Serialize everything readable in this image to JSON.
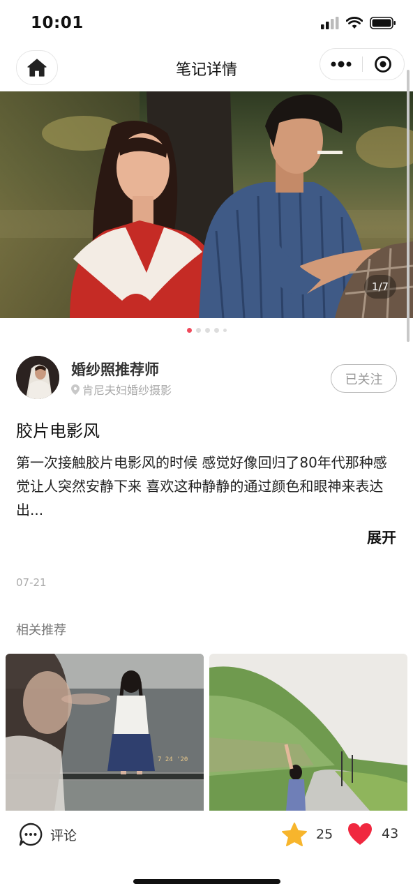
{
  "status_bar": {
    "time": "10:01"
  },
  "nav": {
    "title": "笔记详情"
  },
  "hero": {
    "counter": "1/7",
    "current_index": 1,
    "total": 7
  },
  "author": {
    "name": "婚纱照推荐师",
    "location": "肯尼夫妇婚纱摄影",
    "follow_label": "已关注"
  },
  "note": {
    "title": "胶片电影风",
    "body": "第一次接触胶片电影风的时候 感觉好像回归了80年代那种感觉让人突然安静下来 喜欢这种静静的通过颜色和眼神来表达出...",
    "expand_label": "展开",
    "date": "07-21"
  },
  "related": {
    "title": "相关推荐"
  },
  "bottom_bar": {
    "comment_label": "评论",
    "star_count": "25",
    "like_count": "43"
  },
  "colors": {
    "accent_red": "#f0283f",
    "star_yellow": "#f7b52c",
    "dot_active": "#f04a5b"
  },
  "icons": [
    "home-icon",
    "more-icon",
    "close-target-icon",
    "location-pin-icon",
    "comment-icon",
    "star-icon",
    "heart-icon"
  ]
}
